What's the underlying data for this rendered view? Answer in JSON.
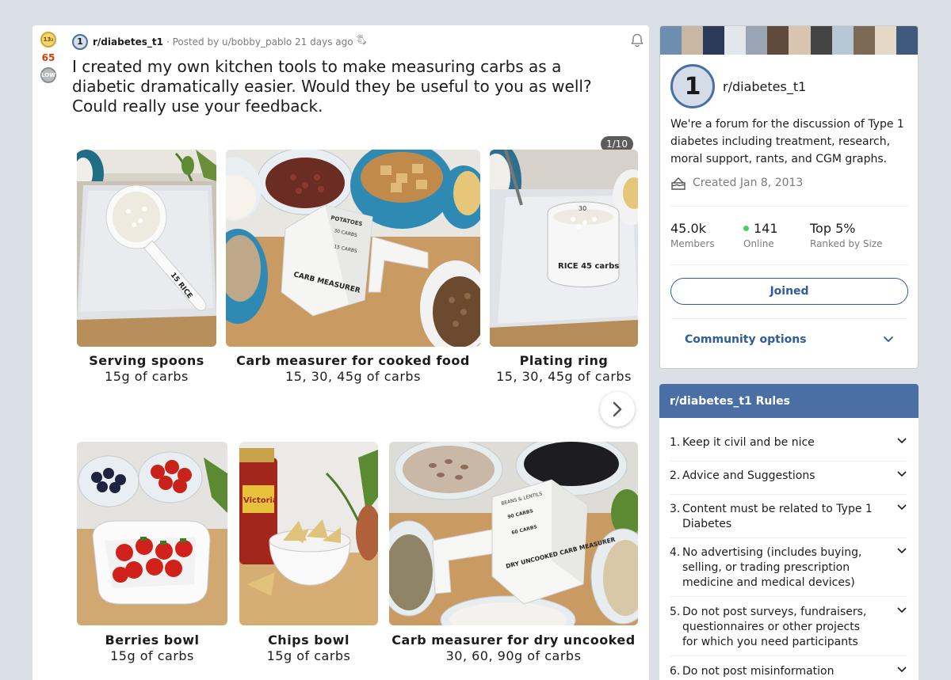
{
  "post": {
    "upvote_badge": "13₂",
    "score": "65",
    "downvote_badge": "LOW",
    "subreddit_icon": "1",
    "subreddit": "r/diabetes_t1",
    "posted_by": "· Posted by u/bobby_pablo 21 days ago",
    "award_icon": "🖏",
    "title": "I created my own kitchen tools to make measuring carbs as a diabetic dramatically easier. Would they be useful to you as well? Could really use your feedback.",
    "gallery_counter": "1/10",
    "items": [
      {
        "name": "Serving spoons",
        "carbs": "15g of carbs"
      },
      {
        "name": "Carb measurer for cooked food",
        "carbs": "15, 30, 45g of carbs"
      },
      {
        "name": "Plating ring",
        "carbs": "15, 30, 45g of carbs"
      },
      {
        "name": "Berries bowl",
        "carbs": "15g of carbs"
      },
      {
        "name": "Chips bowl",
        "carbs": "15g of carbs"
      },
      {
        "name": "Carb measurer for dry uncooked",
        "carbs": "30, 60, 90g of carbs"
      }
    ],
    "photo_text": {
      "spoon": "15 RICE",
      "cup_title": "CARB MEASURER",
      "cup_lines": [
        "POTATOES",
        "30 CARBS",
        "15 CARBS"
      ],
      "ring": "RICE 45 carbs",
      "ring_num": "30",
      "dry_title": "DRY UNCOOKED CARB MEASURER",
      "dry_lines": [
        "BEANS & LENTILS",
        "90 CARBS",
        "60 CARBS"
      ],
      "salsa": "Victoria"
    }
  },
  "about": {
    "icon": "1",
    "name": "r/diabetes_t1",
    "description": "We're a forum for the discussion of Type 1 diabetes including treatment, research, moral support, rants, and CGM graphs.",
    "created": "Created Jan 8, 2013",
    "members_value": "45.0k",
    "members_label": "Members",
    "online_value": "141",
    "online_label": "Online",
    "rank_value": "Top 5%",
    "rank_label": "Ranked by Size",
    "join_label": "Joined",
    "options_label": "Community options"
  },
  "rules": {
    "title": "r/diabetes_t1 Rules",
    "items": [
      {
        "num": "1.",
        "text": "Keep it civil and be nice"
      },
      {
        "num": "2.",
        "text": "Advice and Suggestions"
      },
      {
        "num": "3.",
        "text": "Content must be related to Type 1 Diabetes"
      },
      {
        "num": "4.",
        "text": "No advertising (includes buying, selling, or trading prescription medicine and medical devices)"
      },
      {
        "num": "5.",
        "text": "Do not post surveys, fundraisers, questionnaires or other projects for which you need participants"
      },
      {
        "num": "6.",
        "text": "Do not post misinformation"
      }
    ]
  },
  "colors": {
    "accent": "#4a6fa5",
    "score": "#d93a00",
    "online_dot": "#46d160",
    "background": "#dae0e6"
  }
}
